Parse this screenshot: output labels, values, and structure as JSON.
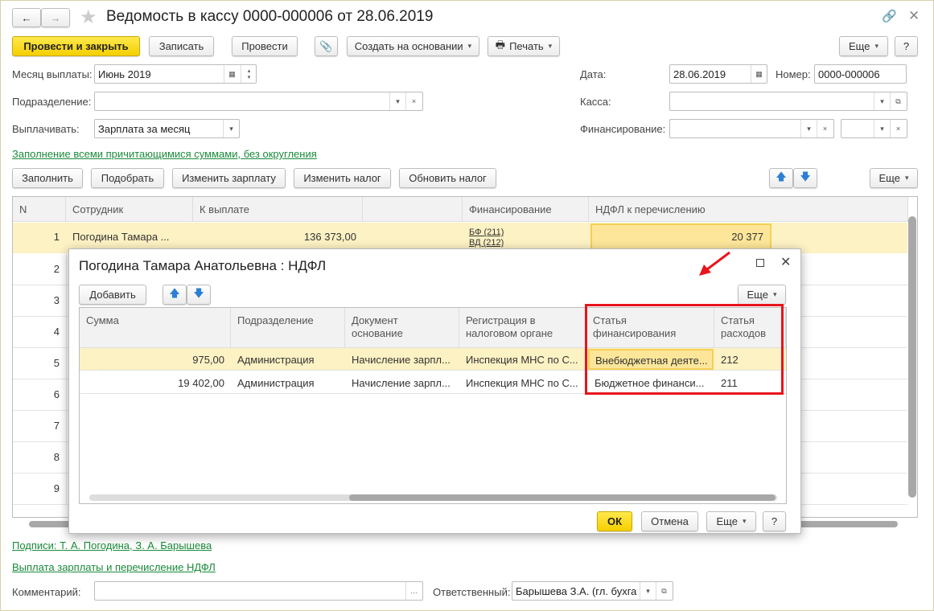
{
  "window": {
    "title": "Ведомость в кассу 0000-000006 от 28.06.2019"
  },
  "toolbar": {
    "post_close": "Провести и закрыть",
    "save": "Записать",
    "post": "Провести",
    "create_based": "Создать на основании",
    "print": "Печать",
    "more": "Еще",
    "help": "?"
  },
  "form": {
    "month_label": "Месяц выплаты:",
    "month_value": "Июнь 2019",
    "date_label": "Дата:",
    "date_value": "28.06.2019",
    "number_label": "Номер:",
    "number_value": "0000-000006",
    "division_label": "Подразделение:",
    "division_value": "",
    "cash_label": "Касса:",
    "cash_value": "",
    "pay_label": "Выплачивать:",
    "pay_value": "Зарплата за месяц",
    "financing_label": "Финансирование:",
    "financing_value": "",
    "fill_link": "Заполнение всеми причитающимися суммами, без округления"
  },
  "table_toolbar": {
    "fill": "Заполнить",
    "pick": "Подобрать",
    "change_salary": "Изменить зарплату",
    "change_tax": "Изменить налог",
    "update_tax": "Обновить налог",
    "more": "Еще"
  },
  "table": {
    "columns": [
      "N",
      "Сотрудник",
      "К выплате",
      "",
      "Финансирование",
      "НДФЛ к перечислению"
    ],
    "rows": [
      {
        "n": "1",
        "employee": "Погодина Тамара ...",
        "amount": "136 373,00",
        "fin1": "БФ (211)",
        "fin2": "ВД (212)",
        "ndfl": "20 377"
      },
      {
        "n": "2"
      },
      {
        "n": "3"
      },
      {
        "n": "4"
      },
      {
        "n": "5"
      },
      {
        "n": "6"
      },
      {
        "n": "7"
      },
      {
        "n": "8"
      },
      {
        "n": "9"
      }
    ]
  },
  "footer": {
    "signatures_link": "Подписи: Т. А. Погодина, З. А. Барышева",
    "payment_link": "Выплата зарплаты и перечисление НДФЛ",
    "comment_label": "Комментарий:",
    "comment_value": "",
    "responsible_label": "Ответственный:",
    "responsible_value": "Барышева З.А. (гл. бухга"
  },
  "dialog": {
    "title": "Погодина Тамара Анатольевна : НДФЛ",
    "add": "Добавить",
    "more": "Еще",
    "columns": [
      "Сумма",
      "Подразделение",
      "Документ основание",
      "Регистрация в налоговом органе",
      "Статья финансирования",
      "Статья расходов"
    ],
    "rows": [
      {
        "sum": "975,00",
        "division": "Администрация",
        "doc": "Начисление зарпл...",
        "reg": "Инспекция МНС по С...",
        "fin": "Внебюджетная деяте...",
        "exp": "212"
      },
      {
        "sum": "19 402,00",
        "division": "Администрация",
        "doc": "Начисление зарпл...",
        "reg": "Инспекция МНС по С...",
        "fin": "Бюджетное финанси...",
        "exp": "211"
      }
    ],
    "ok": "ОК",
    "cancel": "Отмена",
    "help": "?"
  },
  "colors": {
    "accent_yellow": "#f5cf00",
    "selected_row": "#fdf2c4",
    "link_green": "#1a8a3a",
    "annotation_red": "#e8141b"
  }
}
